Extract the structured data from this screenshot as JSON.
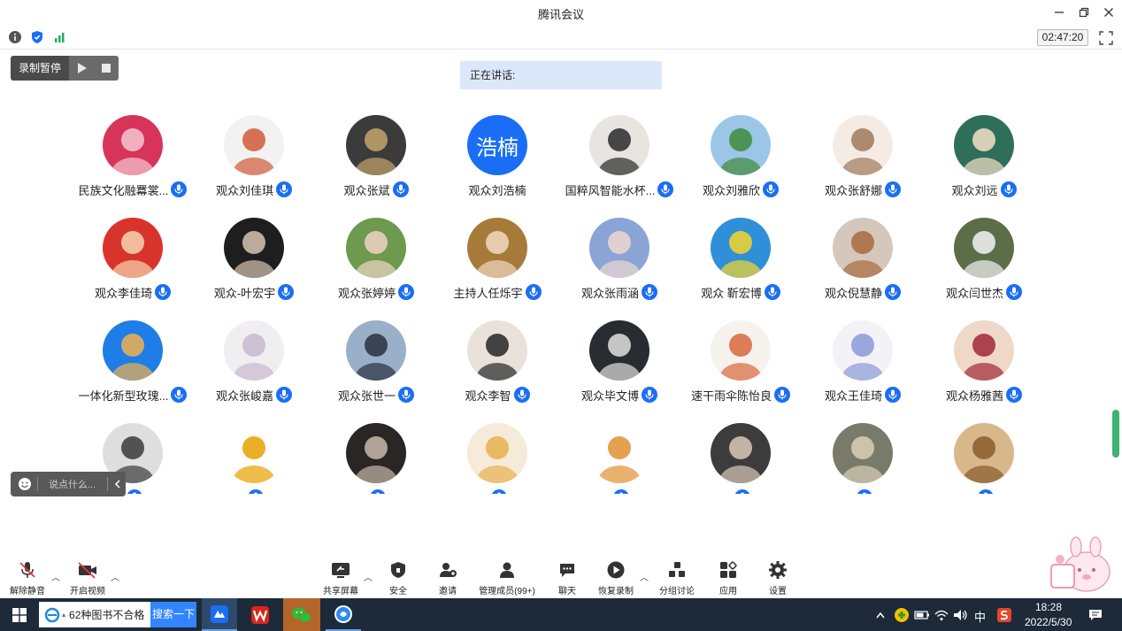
{
  "window": {
    "title": "腾讯会议"
  },
  "infobar": {
    "timer": "02:47:20"
  },
  "recording": {
    "label": "录制暂停"
  },
  "speaking": {
    "label": "正在讲话:"
  },
  "participants": [
    {
      "name": "民族文化融羃裳..."
    },
    {
      "name": "观众刘佳琪"
    },
    {
      "name": "观众张斌"
    },
    {
      "name": "观众刘浩楠",
      "initials": "浩楠"
    },
    {
      "name": "国粹风智能水杯..."
    },
    {
      "name": "观众刘雅欣"
    },
    {
      "name": "观众张舒娜"
    },
    {
      "name": "观众刘远"
    },
    {
      "name": "观众李佳琦"
    },
    {
      "name": "观众-叶宏宇"
    },
    {
      "name": "观众张婷婷"
    },
    {
      "name": "主持人任烁宇"
    },
    {
      "name": "观众张雨涵"
    },
    {
      "name": "观众 靳宏博"
    },
    {
      "name": "观众倪慧静"
    },
    {
      "name": "观众闫世杰"
    },
    {
      "name": "一体化新型玫瑰..."
    },
    {
      "name": "观众张峻嘉"
    },
    {
      "name": "观众张世一"
    },
    {
      "name": "观众李智"
    },
    {
      "name": "观众毕文博"
    },
    {
      "name": "速干雨伞陈怡良"
    },
    {
      "name": "观众王佳琦"
    },
    {
      "name": "观众杨雅茜"
    },
    {
      "name": ""
    },
    {
      "name": ""
    },
    {
      "name": ""
    },
    {
      "name": ""
    },
    {
      "name": ""
    },
    {
      "name": ""
    },
    {
      "name": ""
    },
    {
      "name": ""
    }
  ],
  "chat": {
    "placeholder": "说点什么..."
  },
  "toolbar": {
    "unmute": "解除静音",
    "start_video": "开启视频",
    "share_screen": "共享屏幕",
    "security": "安全",
    "invite": "邀请",
    "manage_members": "管理成员(99+)",
    "chat": "聊天",
    "resume_recording": "恢复录制",
    "breakout": "分组讨论",
    "apps": "应用",
    "settings": "设置"
  },
  "taskbar": {
    "search_query": "62种图书不合格",
    "search_button": "搜索一下",
    "ime": "中",
    "time": "18:28",
    "date": "2022/5/30"
  },
  "colors": {
    "accent": "#1a6ef5",
    "speaking_bg": "#dbe8fb",
    "taskbar": "#1c2a3a"
  }
}
